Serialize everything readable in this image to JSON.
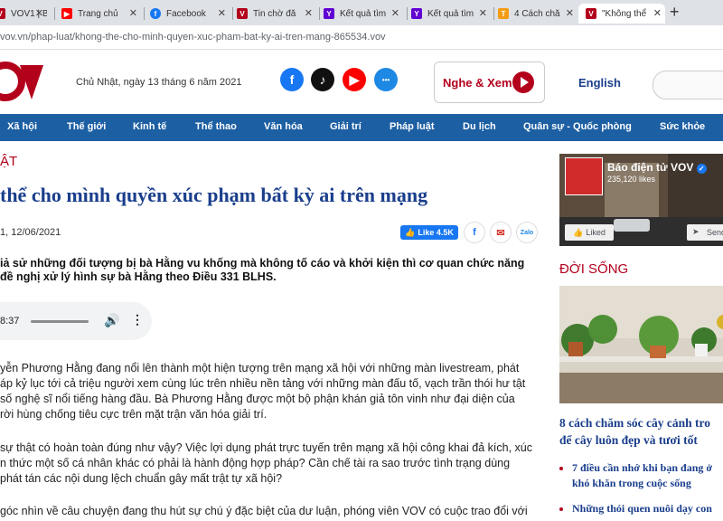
{
  "browser": {
    "tabs": [
      {
        "label": "VOV1 | BÁO",
        "favicon": "vov",
        "active": false
      },
      {
        "label": "Trang chủ",
        "favicon": "youtube",
        "active": false
      },
      {
        "label": "Facebook",
        "favicon": "facebook",
        "active": false
      },
      {
        "label": "Tin chờ đă",
        "favicon": "vov",
        "active": false
      },
      {
        "label": "Kết quả tìm",
        "favicon": "yahoo",
        "active": false
      },
      {
        "label": "Kết quả tìm",
        "favicon": "yahoo",
        "active": false
      },
      {
        "label": "4 Cách chă",
        "favicon": "t",
        "active": false
      },
      {
        "label": "\"Không thể",
        "favicon": "vov",
        "active": true
      }
    ],
    "new_tab_label": "+",
    "url": "vov.vn/phap-luat/khong-the-cho-minh-quyen-xuc-pham-bat-ky-ai-tren-mang-865534.vov"
  },
  "header": {
    "date": "Chủ Nhật, ngày 13 tháng 6 năm 2021",
    "nghe_xem": "Nghe & Xem",
    "english": "English",
    "social_icons": [
      "facebook-icon",
      "tiktok-icon",
      "youtube-icon",
      "zalo-icon"
    ]
  },
  "nav": {
    "items": [
      "Xã hội",
      "Thế giới",
      "Kinh tế",
      "Thể thao",
      "Văn hóa",
      "Giải trí",
      "Pháp luật",
      "Du lịch",
      "Quân sự - Quốc phòng",
      "Sức khỏe"
    ]
  },
  "article": {
    "category": "ẬT",
    "title": "thể cho mình quyền xúc phạm bất kỳ ai trên mạng",
    "pubdate": "1, 12/06/2021",
    "like_label": "Like 4.5K",
    "sapo_lines": [
      "iả sử những đối tượng bị bà Hằng vu khống mà không tố cáo và khởi kiện thì cơ quan chức năng",
      "đề nghị xử lý hình sự bà Hằng theo Điều 331 BLHS."
    ],
    "audio_time": "8:37",
    "paragraphs": [
      [
        "yễn Phương Hằng đang nổi lên thành một hiện tượng trên mạng xã hội với những màn livestream, phát",
        "áp kỷ lục tới cả triệu người xem cùng lúc trên nhiều nền tảng với những màn đấu tố, vạch trần thói hư tật",
        "số nghệ sĩ nổi tiếng hàng đầu. Bà Phương Hằng được một bộ phận khán giả tôn vinh như đại diện của",
        "rời hùng chống tiêu cực trên mặt trận văn hóa giải trí."
      ],
      [
        "sự thật có hoàn toàn đúng như vậy? Việc lợi dụng phát trực tuyến trên mạng xã hội công khai đả kích, xúc",
        "n thức một số cá nhân khác có phải là hành động hợp pháp? Cần chế tài ra sao trước tình trạng dùng",
        "phát tán các nội dung lệch chuẩn gây mất trật tự xã hội?"
      ],
      [
        "góc nhìn về câu chuyện đang thu hút sự chú ý đặc biệt của dư luận, phóng viên VOV có cuộc trao đổi với"
      ]
    ]
  },
  "sidebar": {
    "fb_page_name": "Báo điện tử VOV",
    "fb_likes": "235,120 likes",
    "fb_liked": "Liked",
    "fb_send": "Send",
    "section_title": "ĐỜI SỐNG",
    "headline_lines": [
      "8 cách chăm sóc cây cảnh tro",
      "để cây luôn đẹp và tươi tốt"
    ],
    "items": [
      [
        "7 điều cần nhớ khi bạn đang ở",
        "khó khăn trong cuộc sống"
      ],
      [
        "Những thói quen nuôi dạy con",
        ""
      ]
    ]
  },
  "colors": {
    "brand_red": "#b3001b",
    "nav_blue": "#1d5fa3",
    "title_blue": "#1a3e8c",
    "facebook_blue": "#1877f2"
  }
}
